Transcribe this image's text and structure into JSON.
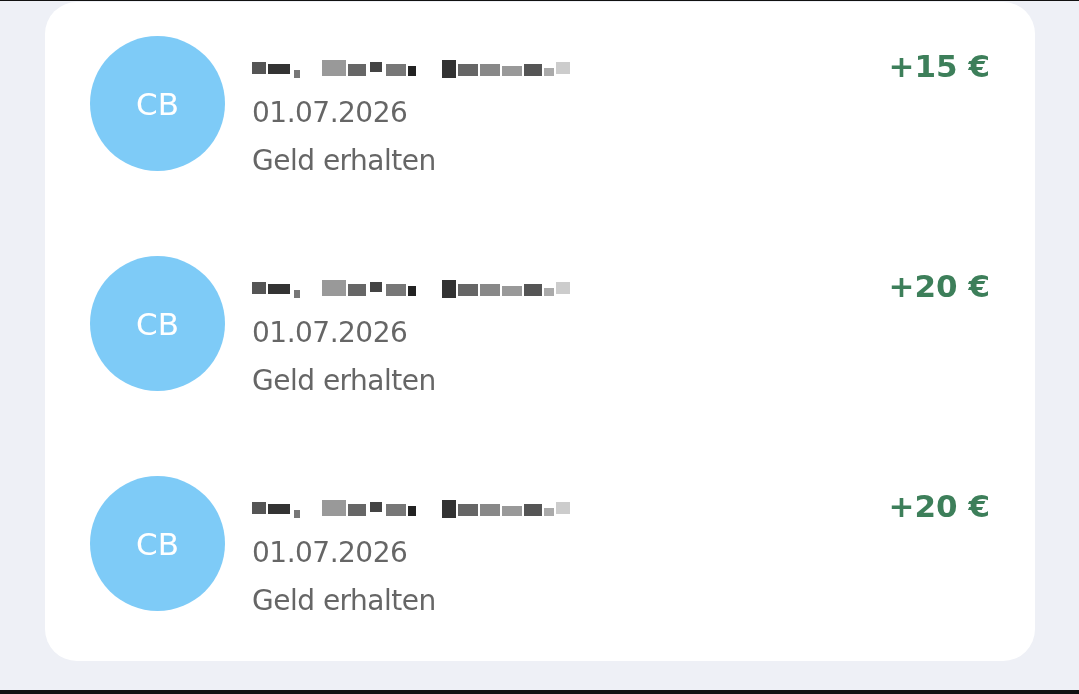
{
  "transactions": [
    {
      "initials": "CB",
      "date": "01.07.2026",
      "description": "Geld erhalten",
      "amount": "+15 €"
    },
    {
      "initials": "CB",
      "date": "01.07.2026",
      "description": "Geld erhalten",
      "amount": "+20 €"
    },
    {
      "initials": "CB",
      "date": "01.07.2026",
      "description": "Geld erhalten",
      "amount": "+20 €"
    }
  ]
}
